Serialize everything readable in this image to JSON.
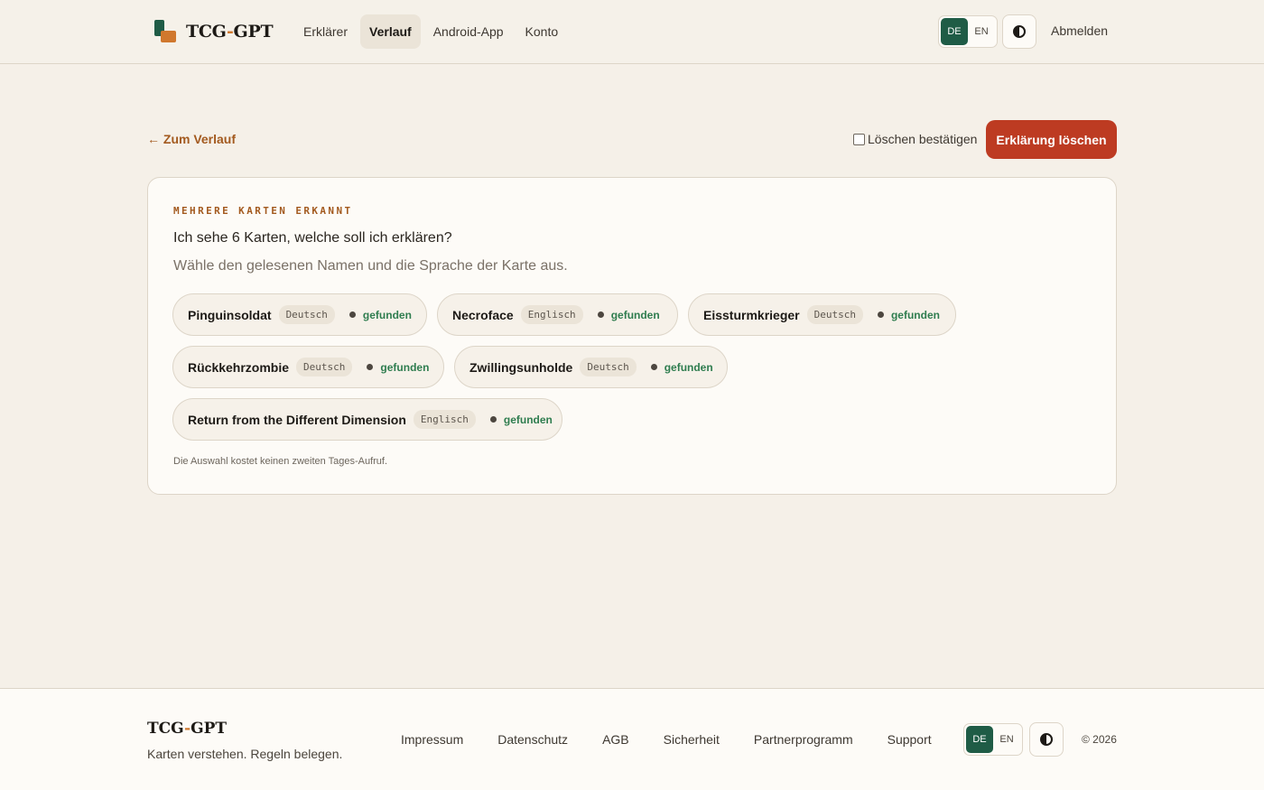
{
  "header": {
    "brand_main": "TCG",
    "brand_dash": "-",
    "brand_tail": "GPT",
    "nav": [
      {
        "label": "Erklärer",
        "active": false
      },
      {
        "label": "Verlauf",
        "active": true
      },
      {
        "label": "Android-App",
        "active": false
      },
      {
        "label": "Konto",
        "active": false
      }
    ],
    "lang": {
      "de": "DE",
      "en": "EN",
      "active": "DE"
    },
    "theme_icon": "contrast-icon",
    "logout": "Abmelden"
  },
  "actions": {
    "back": "← Zum Verlauf",
    "confirm_label": "Löschen bestätigen",
    "confirm_checked": false,
    "delete": "Erklärung löschen"
  },
  "panel": {
    "eyebrow": "MEHRERE KARTEN ERKANNT",
    "question": "Ich sehe 6 Karten, welche soll ich erklären?",
    "hint": "Wähle den gelesenen Namen und die Sprache der Karte aus.",
    "cards": [
      {
        "name": "Pinguinsoldat",
        "language": "Deutsch",
        "status": "gefunden"
      },
      {
        "name": "Necroface",
        "language": "Englisch",
        "status": "gefunden"
      },
      {
        "name": "Eissturmkrieger",
        "language": "Deutsch",
        "status": "gefunden"
      },
      {
        "name": "Rückkehrzombie",
        "language": "Deutsch",
        "status": "gefunden"
      },
      {
        "name": "Zwillingsunholde",
        "language": "Deutsch",
        "status": "gefunden"
      },
      {
        "name": "Return from the Different Dimension",
        "language": "Englisch",
        "status": "gefunden"
      }
    ],
    "footnote": "Die Auswahl kostet keinen zweiten Tages-Aufruf."
  },
  "footer": {
    "brand_main": "TCG",
    "brand_dash": "-",
    "brand_tail": "GPT",
    "tagline": "Karten verstehen. Regeln belegen.",
    "links": [
      "Impressum",
      "Datenschutz",
      "AGB",
      "Sicherheit",
      "Partnerprogramm",
      "Support"
    ],
    "lang": {
      "de": "DE",
      "en": "EN",
      "active": "DE"
    },
    "copyright": "© 2026"
  },
  "colors": {
    "accent_green": "#1f5c46",
    "accent_orange": "#d0782e",
    "danger": "#bd3b22",
    "link": "#a35a1f",
    "status_green": "#2f7d4f"
  }
}
